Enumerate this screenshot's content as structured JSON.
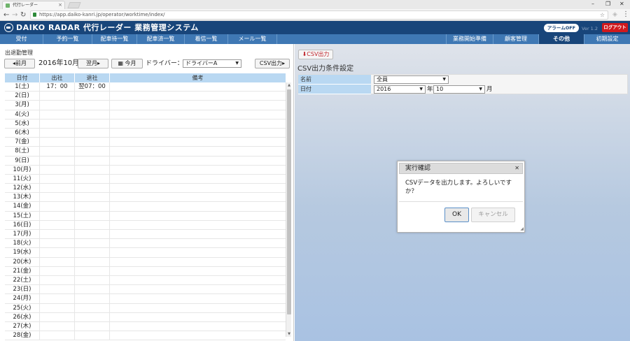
{
  "browser": {
    "tab_title": "代行レーダー",
    "url": "https://app.daiko-kanri.jp/operator/worktime/index/"
  },
  "header": {
    "brand": "DAIKO RADAR 代行レーダー 業務管理システム",
    "alarm_label": "アラームOFF",
    "version": "Ver 1.2",
    "logout_label": "ログアウト"
  },
  "nav": {
    "items": [
      {
        "label": "受付"
      },
      {
        "label": "予約一覧"
      },
      {
        "label": "配車待一覧"
      },
      {
        "label": "配車済一覧"
      },
      {
        "label": "着信一覧"
      },
      {
        "label": "メール一覧"
      },
      {
        "label": "業務開始準備"
      },
      {
        "label": "顧客管理"
      },
      {
        "label": "その他"
      },
      {
        "label": "初期設定"
      }
    ]
  },
  "attendance": {
    "title": "出退勤管理",
    "prev_label": "前月",
    "month": "2016年10月",
    "next_label": "翌月",
    "today_label": "今月",
    "driver_label": "ドライバー：",
    "driver_selected": "ドライバーA",
    "csv_label": "CSV出力",
    "columns": [
      "日付",
      "出社",
      "退社",
      "備考"
    ],
    "rows": [
      {
        "date": "1(土)",
        "in": "17：00",
        "out": "翌07：00",
        "note": ""
      },
      {
        "date": "2(日)",
        "in": "",
        "out": "",
        "note": ""
      },
      {
        "date": "3(月)",
        "in": "",
        "out": "",
        "note": ""
      },
      {
        "date": "4(火)",
        "in": "",
        "out": "",
        "note": ""
      },
      {
        "date": "5(水)",
        "in": "",
        "out": "",
        "note": ""
      },
      {
        "date": "6(木)",
        "in": "",
        "out": "",
        "note": ""
      },
      {
        "date": "7(金)",
        "in": "",
        "out": "",
        "note": ""
      },
      {
        "date": "8(土)",
        "in": "",
        "out": "",
        "note": ""
      },
      {
        "date": "9(日)",
        "in": "",
        "out": "",
        "note": ""
      },
      {
        "date": "10(月)",
        "in": "",
        "out": "",
        "note": ""
      },
      {
        "date": "11(火)",
        "in": "",
        "out": "",
        "note": ""
      },
      {
        "date": "12(水)",
        "in": "",
        "out": "",
        "note": ""
      },
      {
        "date": "13(木)",
        "in": "",
        "out": "",
        "note": ""
      },
      {
        "date": "14(金)",
        "in": "",
        "out": "",
        "note": ""
      },
      {
        "date": "15(土)",
        "in": "",
        "out": "",
        "note": ""
      },
      {
        "date": "16(日)",
        "in": "",
        "out": "",
        "note": ""
      },
      {
        "date": "17(月)",
        "in": "",
        "out": "",
        "note": ""
      },
      {
        "date": "18(火)",
        "in": "",
        "out": "",
        "note": ""
      },
      {
        "date": "19(水)",
        "in": "",
        "out": "",
        "note": ""
      },
      {
        "date": "20(木)",
        "in": "",
        "out": "",
        "note": ""
      },
      {
        "date": "21(金)",
        "in": "",
        "out": "",
        "note": ""
      },
      {
        "date": "22(土)",
        "in": "",
        "out": "",
        "note": ""
      },
      {
        "date": "23(日)",
        "in": "",
        "out": "",
        "note": ""
      },
      {
        "date": "24(月)",
        "in": "",
        "out": "",
        "note": ""
      },
      {
        "date": "25(火)",
        "in": "",
        "out": "",
        "note": ""
      },
      {
        "date": "26(水)",
        "in": "",
        "out": "",
        "note": ""
      },
      {
        "date": "27(木)",
        "in": "",
        "out": "",
        "note": ""
      },
      {
        "date": "28(金)",
        "in": "",
        "out": "",
        "note": ""
      }
    ]
  },
  "csv_panel": {
    "button_label": "CSV出力",
    "title": "CSV出力条件設定",
    "name_label": "名前",
    "name_value": "全員",
    "date_label": "日付",
    "year_value": "2016",
    "year_unit": "年",
    "month_value": "10",
    "month_unit": "月"
  },
  "dialog": {
    "title": "実行確認",
    "message": "CSVデータを出力します。よろしいですか？",
    "ok_label": "OK",
    "cancel_label": "キャンセル"
  },
  "colors": {
    "header_bg": "#18457a",
    "nav_bg": "#3f78b4",
    "table_header": "#b9d8f2",
    "logout": "#d0191d"
  }
}
